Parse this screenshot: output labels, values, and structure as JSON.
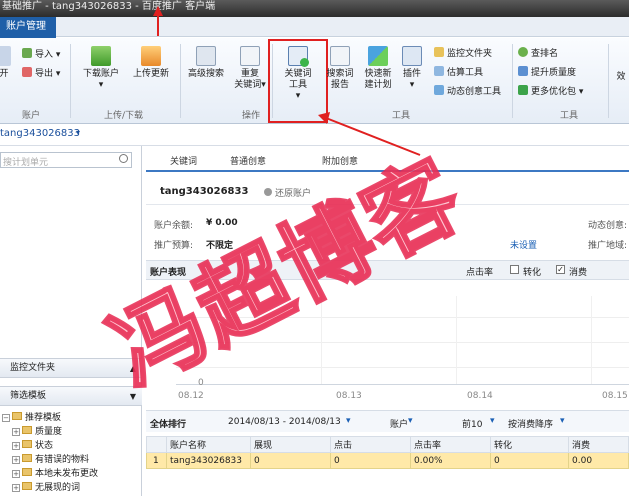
{
  "window": {
    "title": "基础推广 - tang343026833 - 百度推广 客户端"
  },
  "menubar": {
    "active_tab": "账户管理"
  },
  "ribbon": {
    "import_label": "导入",
    "export_label": "导出",
    "account_left_label": "开",
    "group_account": "账户",
    "group_updown": "上传/下载",
    "group_ops": "操作",
    "group_tools": "工具",
    "group_rank": "工具",
    "download_label": "下载账户",
    "upload_label": "上传更新",
    "advanced_search_label": "高级搜索",
    "dup_kw_label1": "重复",
    "dup_kw_label2": "关键词",
    "kw_tool_label1": "关键词",
    "kw_tool_label2": "工具",
    "search_report_label1": "搜索词",
    "search_report_label2": "报告",
    "quick_plan_label1": "快速新",
    "quick_plan_label2": "建计划",
    "plugin_label": "插件",
    "monitor_folder": "监控文件夹",
    "estimate_tool": "估算工具",
    "dynamic_tool": "动态创意工具",
    "rank": "查排名",
    "quality": "提升质量度",
    "more": "更多优化包",
    "right_cut": "效"
  },
  "account_bar": {
    "account": "tang343026833"
  },
  "sidebar": {
    "search_placeholder": "搜计划单元",
    "monitor_title": "监控文件夹",
    "filter_title": "筛选模板",
    "tree": [
      "推荐模板",
      "质量度",
      "状态",
      "有错误的物料",
      "本地未发布更改",
      "无展现的词"
    ]
  },
  "main": {
    "tabs": [
      "关键词",
      "普通创意",
      "附加创意"
    ],
    "account_name": "tang343026833",
    "restore": "还原账户",
    "balance_label": "账户余额:",
    "balance": "¥ 0.00",
    "budget_label": "推广预算:",
    "budget": "不限定",
    "area_value": "未设置",
    "dyn_label": "动态创意:",
    "region_label": "推广地域:",
    "perf_title": "账户表现",
    "chk_ctr": "点击率",
    "chk_conv": "转化",
    "chk_cost": "消费",
    "x_ticks": [
      "08.12",
      "08.13",
      "08.14",
      "08.15"
    ],
    "y_tick": "0",
    "rank_title": "全体排行",
    "date_range": "2014/08/13 - 2014/08/13",
    "dim": "账户",
    "topn": "前10",
    "sort": "按消费降序",
    "cols": [
      "",
      "账户名称",
      "展现",
      "点击",
      "点击率",
      "转化",
      "消费"
    ],
    "rows": [
      [
        "1",
        "tang343026833",
        "0",
        "0",
        "0.00%",
        "0",
        "0.00"
      ]
    ]
  },
  "watermark": {
    "text": "冯超博客"
  }
}
